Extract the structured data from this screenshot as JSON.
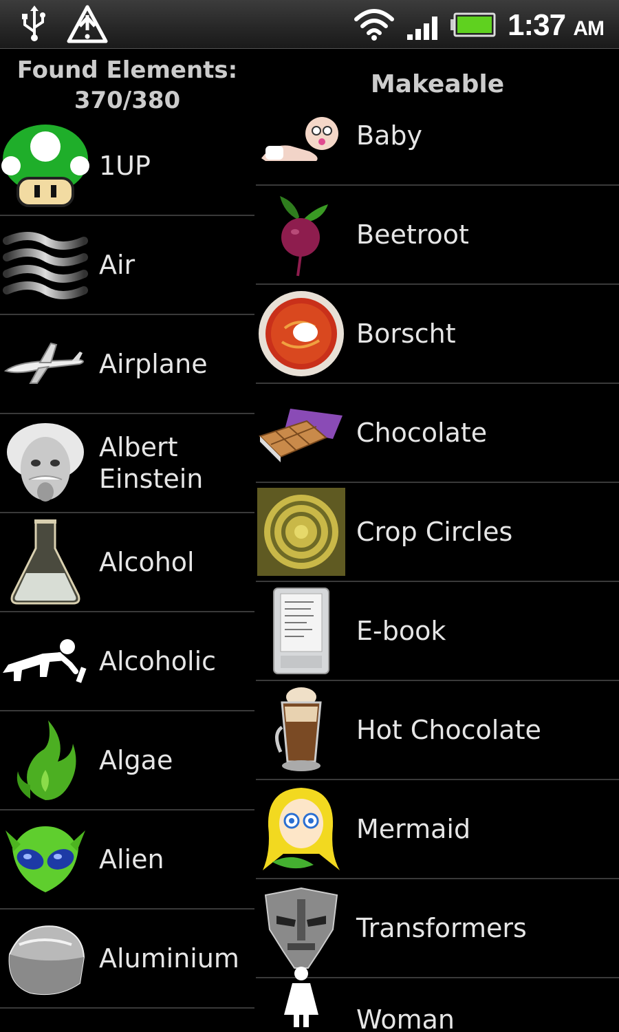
{
  "status_bar": {
    "time": "1:37",
    "ampm": "AM",
    "icons": [
      "usb-icon",
      "warning-icon",
      "wifi-icon",
      "signal-icon",
      "battery-icon"
    ]
  },
  "found": {
    "title": "Found Elements:",
    "count": "370/380"
  },
  "makeable": {
    "title": "Makeable"
  },
  "left_items": [
    {
      "label": "1UP",
      "icon": "mushroom-icon"
    },
    {
      "label": "Air",
      "icon": "air-icon"
    },
    {
      "label": "Airplane",
      "icon": "airplane-icon"
    },
    {
      "label": "Albert\nEinstein",
      "icon": "einstein-icon"
    },
    {
      "label": "Alcohol",
      "icon": "flask-icon"
    },
    {
      "label": "Alcoholic",
      "icon": "crawling-man-icon"
    },
    {
      "label": "Algae",
      "icon": "algae-icon"
    },
    {
      "label": "Alien",
      "icon": "alien-icon"
    },
    {
      "label": "Aluminium",
      "icon": "aluminium-icon"
    }
  ],
  "right_items": [
    {
      "label": "Baby",
      "icon": "baby-icon"
    },
    {
      "label": "Beetroot",
      "icon": "beetroot-icon"
    },
    {
      "label": "Borscht",
      "icon": "borscht-icon"
    },
    {
      "label": "Chocolate",
      "icon": "chocolate-icon"
    },
    {
      "label": "Crop Circles",
      "icon": "crop-circles-icon"
    },
    {
      "label": "E-book",
      "icon": "ebook-icon"
    },
    {
      "label": "Hot Chocolate",
      "icon": "hot-chocolate-icon"
    },
    {
      "label": "Mermaid",
      "icon": "mermaid-icon"
    },
    {
      "label": "Transformers",
      "icon": "transformers-icon"
    },
    {
      "label": "Woman",
      "icon": "woman-icon"
    }
  ],
  "colors": {
    "background": "#000000",
    "divider": "#3a3a3a",
    "text": "#e6e6e6",
    "battery": "#5fd11f"
  }
}
